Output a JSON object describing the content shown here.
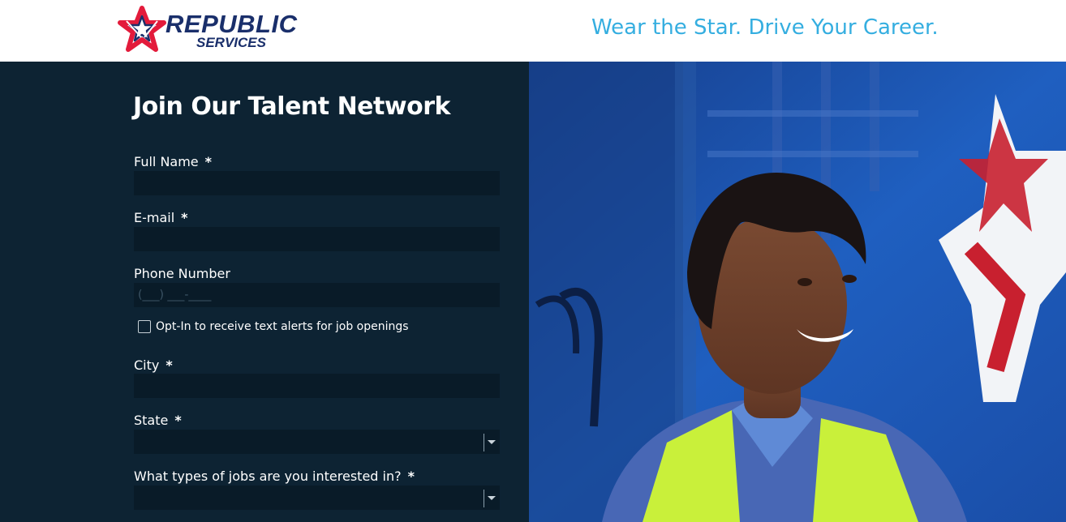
{
  "brand": {
    "logo_line1": "REPUBLIC",
    "logo_line2": "SERVICES",
    "primary_color": "#1a2f6b",
    "accent_color": "#e31b3b"
  },
  "header": {
    "tagline": "Wear the Star. Drive Your Career.",
    "tagline_color": "#35aee0"
  },
  "form": {
    "title": "Join Our Talent Network",
    "panel_color": "#0d2333",
    "required_marker": "*",
    "fields": {
      "full_name": {
        "label": "Full Name",
        "value": "",
        "placeholder": ""
      },
      "email": {
        "label": "E-mail",
        "value": "",
        "placeholder": ""
      },
      "phone": {
        "label": "Phone Number",
        "value": "",
        "placeholder": "(___) ___-____"
      },
      "city": {
        "label": "City",
        "value": "",
        "placeholder": ""
      },
      "state": {
        "label": "State",
        "selected": ""
      },
      "job_types": {
        "label": "What types of jobs are you interested in?",
        "selected": ""
      }
    },
    "sms_opt_in": {
      "label": "Opt-In to receive text alerts for job openings",
      "checked": false
    }
  },
  "hero": {
    "icons": [
      "star-logo-icon"
    ]
  }
}
